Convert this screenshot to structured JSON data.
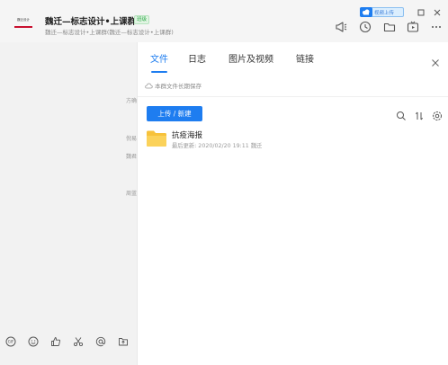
{
  "header": {
    "logo_text": "魏迁设计",
    "group_name": "魏迁—标志设计•上课群",
    "badge": "班级",
    "group_sub": "魏迁—标志设计•上课群(魏迁—标志设计•上课群)",
    "upload_tag": "视频上传"
  },
  "chat": {
    "hints": [
      "方确",
      "倪易",
      "魏君",
      "周蓝"
    ]
  },
  "panel": {
    "tabs": [
      {
        "label": "文件",
        "active": true
      },
      {
        "label": "日志",
        "active": false
      },
      {
        "label": "图片及视频",
        "active": false
      },
      {
        "label": "链接",
        "active": false
      }
    ],
    "note": "本群文件长期保存",
    "upload_button": "上传 / 新建",
    "files": [
      {
        "name": "抗疫海报",
        "meta": "最后更新: 2020/02/20 19:11  魏迁"
      }
    ]
  },
  "colors": {
    "accent": "#1e7df0",
    "folder": "#f7c23b",
    "badge_green": "#2eaa4a"
  }
}
